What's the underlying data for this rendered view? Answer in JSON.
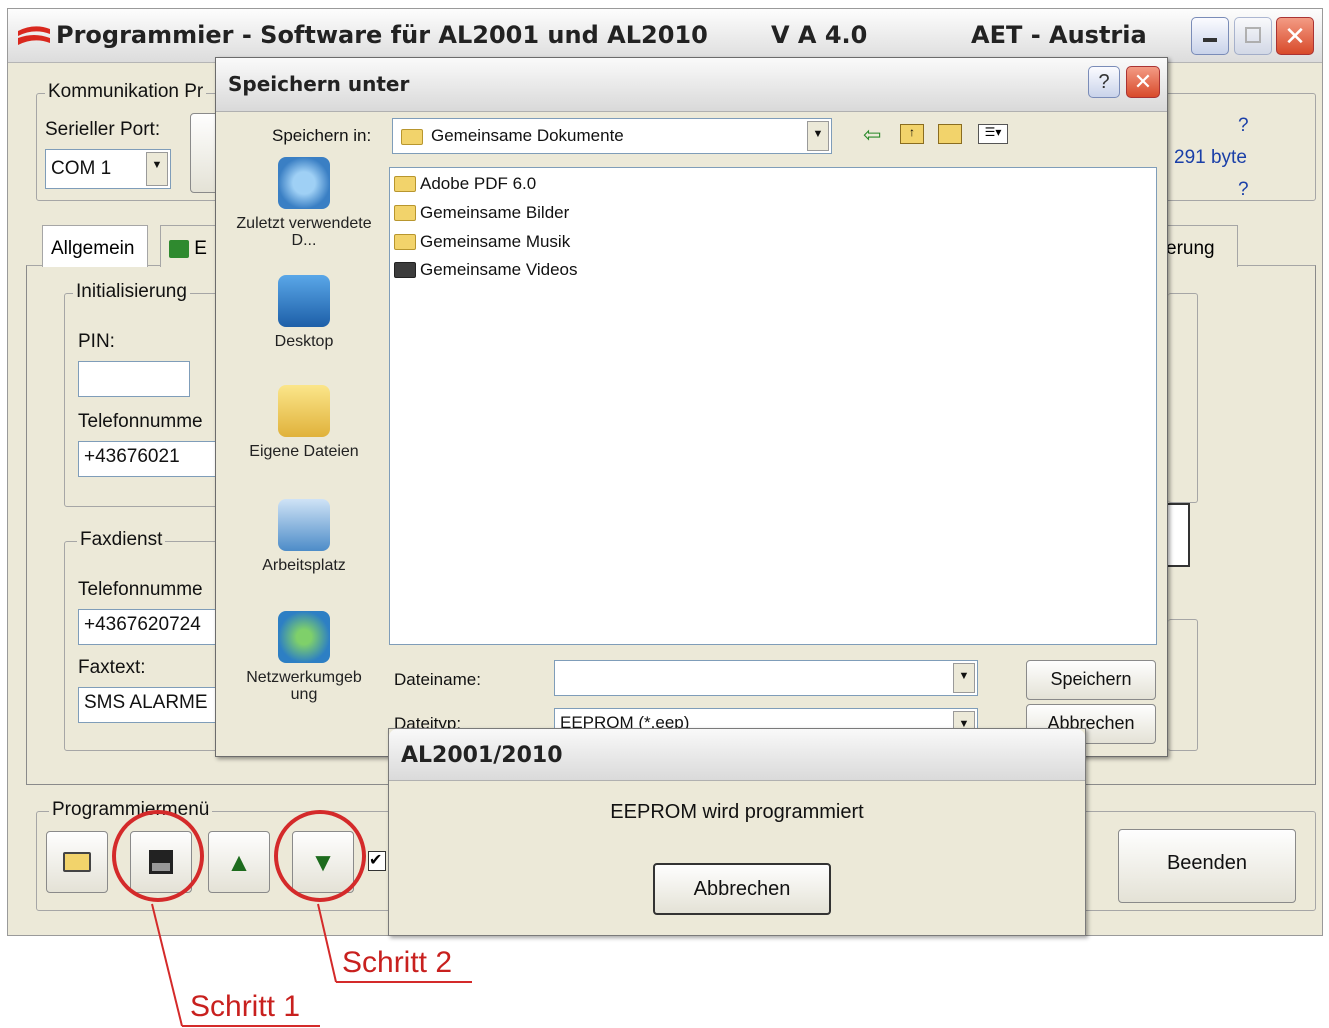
{
  "main_window": {
    "title": "Programmier - Software für AL2001 und AL2010",
    "version": "V A 4.0",
    "company": "AET - Austria",
    "minimize": "_",
    "maximize": "□",
    "close": "✕"
  },
  "communication": {
    "group_label": "Kommunikation Pr",
    "port_label": "Serieller Port:",
    "port_value": "COM 1",
    "info_q1": "?",
    "info_bytes": "291 byte",
    "info_q2": "?"
  },
  "tabs": {
    "general": "Allgemein",
    "second_initial": "E",
    "right_partial": "erung"
  },
  "init": {
    "group_label": "Initialisierung",
    "pin_label": "PIN:",
    "pin_value": "",
    "phone_label": "Telefonnumme",
    "phone_value": "+43676021"
  },
  "fax": {
    "group_label": "Faxdienst",
    "phone_label": "Telefonnumme",
    "phone_value": "+4367620724",
    "text_label": "Faxtext:",
    "text_value": "SMS ALARME"
  },
  "program_menu": {
    "group_label": "Programmiermenü",
    "quit_label": "Beenden"
  },
  "save_dialog": {
    "title": "Speichern unter",
    "help": "?",
    "close": "✕",
    "save_in_label": "Speichern in:",
    "save_in_value": "Gemeinsame Dokumente",
    "places": [
      {
        "label": "Zuletzt verwendete D..."
      },
      {
        "label": "Desktop"
      },
      {
        "label": "Eigene Dateien"
      },
      {
        "label": "Arbeitsplatz"
      },
      {
        "label": "Netzwerkumgeb ung"
      }
    ],
    "files": [
      "Adobe PDF 6.0",
      "Gemeinsame Bilder",
      "Gemeinsame Musik",
      "Gemeinsame Videos"
    ],
    "filename_label": "Dateiname:",
    "filename_value": "",
    "filetype_label": "Dateityp:",
    "filetype_value": "EEPROM (*.eep)",
    "save_button": "Speichern",
    "cancel_button": "Abbrechen"
  },
  "progress_dialog": {
    "title": "AL2001/2010",
    "message": "EEPROM wird programmiert",
    "cancel_button": "Abbrechen"
  },
  "annotations": {
    "step1": "Schritt 1",
    "step2": "Schritt 2",
    "color": "#d42a2a"
  }
}
